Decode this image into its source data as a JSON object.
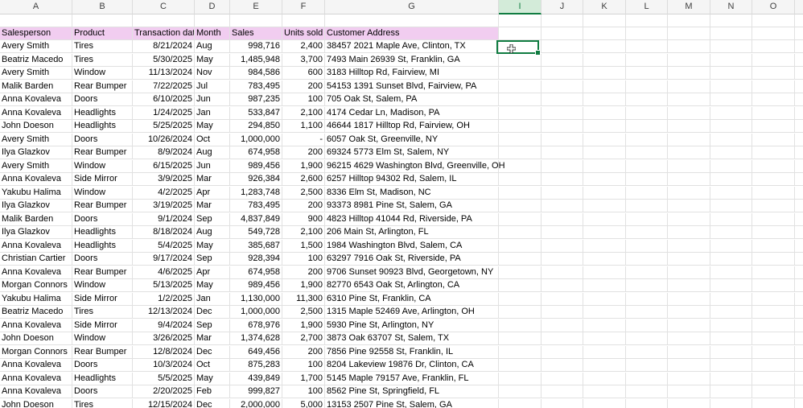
{
  "columns": [
    "A",
    "B",
    "C",
    "D",
    "E",
    "F",
    "G",
    "",
    "I",
    "J",
    "K",
    "L",
    "M",
    "N",
    "O"
  ],
  "selected_column": "I",
  "headers": {
    "salesperson": "Salesperson",
    "product": "Product",
    "transaction_date": "Transaction dat",
    "month": "Month",
    "sales": "Sales",
    "units_sold": "Units sold",
    "customer_address": "Customer Address"
  },
  "rows": [
    [
      "Avery Smith",
      "Tires",
      "8/21/2024",
      "Aug",
      "998,716",
      "2,400",
      "38457 2021 Maple Ave, Clinton, TX"
    ],
    [
      "Beatriz Macedo",
      "Tires",
      "5/30/2025",
      "May",
      "1,485,948",
      "3,700",
      "7493 Main 26939 St, Franklin, GA"
    ],
    [
      "Avery Smith",
      "Window",
      "11/13/2024",
      "Nov",
      "984,586",
      "600",
      "3183 Hilltop Rd, Fairview, MI"
    ],
    [
      "Malik Barden",
      "Rear Bumper",
      "7/22/2025",
      "Jul",
      "783,495",
      "200",
      "54153 1391 Sunset Blvd, Fairview, PA"
    ],
    [
      "Anna Kovaleva",
      "Doors",
      "6/10/2025",
      "Jun",
      "987,235",
      "100",
      "705 Oak St, Salem, PA"
    ],
    [
      "Anna Kovaleva",
      "Headlights",
      "1/24/2025",
      "Jan",
      "533,847",
      "2,100",
      "4174 Cedar Ln, Madison, PA"
    ],
    [
      "John Doeson",
      "Headlights",
      "5/25/2025",
      "May",
      "294,850",
      "1,100",
      "46644 1817 Hilltop Rd, Fairview, OH"
    ],
    [
      "Avery Smith",
      "Doors",
      "10/26/2024",
      "Oct",
      "1,000,000",
      "-",
      "6057 Oak St, Greenville, NY"
    ],
    [
      "Ilya Glazkov",
      "Rear Bumper",
      "8/9/2024",
      "Aug",
      "674,958",
      "200",
      "69324 5773 Elm St, Salem, NY"
    ],
    [
      "Avery Smith",
      "Window",
      "6/15/2025",
      "Jun",
      "989,456",
      "1,900",
      "96215 4629 Washington Blvd, Greenville, OH"
    ],
    [
      "Anna Kovaleva",
      "Side Mirror",
      "3/9/2025",
      "Mar",
      "926,384",
      "2,600",
      "6257 Hilltop 94302 Rd, Salem, IL"
    ],
    [
      "Yakubu Halima",
      "Window",
      "4/2/2025",
      "Apr",
      "1,283,748",
      "2,500",
      "8336 Elm St, Madison, NC"
    ],
    [
      "Ilya Glazkov",
      "Rear Bumper",
      "3/19/2025",
      "Mar",
      "783,495",
      "200",
      "93373 8981 Pine St, Salem, GA"
    ],
    [
      "Malik Barden",
      "Doors",
      "9/1/2024",
      "Sep",
      "4,837,849",
      "900",
      "4823 Hilltop 41044 Rd, Riverside, PA"
    ],
    [
      "Ilya Glazkov",
      "Headlights",
      "8/18/2024",
      "Aug",
      "549,728",
      "2,100",
      "206 Main St, Arlington, FL"
    ],
    [
      "Anna Kovaleva",
      "Headlights",
      "5/4/2025",
      "May",
      "385,687",
      "1,500",
      "1984 Washington Blvd, Salem, CA"
    ],
    [
      "Christian Cartier",
      "Doors",
      "9/17/2024",
      "Sep",
      "928,394",
      "100",
      "63297 7916 Oak St, Riverside, PA"
    ],
    [
      "Anna Kovaleva",
      "Rear Bumper",
      "4/6/2025",
      "Apr",
      "674,958",
      "200",
      "9706 Sunset 90923 Blvd, Georgetown, NY"
    ],
    [
      "Morgan Connors",
      "Window",
      "5/13/2025",
      "May",
      "989,456",
      "1,900",
      "82770 6543 Oak St, Arlington, CA"
    ],
    [
      "Yakubu Halima",
      "Side Mirror",
      "1/2/2025",
      "Jan",
      "1,130,000",
      "11,300",
      "6310 Pine St, Franklin, CA"
    ],
    [
      "Beatriz Macedo",
      "Tires",
      "12/13/2024",
      "Dec",
      "1,000,000",
      "2,500",
      "1315 Maple 52469 Ave, Arlington, OH"
    ],
    [
      "Anna Kovaleva",
      "Side Mirror",
      "9/4/2024",
      "Sep",
      "678,976",
      "1,900",
      "5930 Pine St, Arlington, NY"
    ],
    [
      "John Doeson",
      "Window",
      "3/26/2025",
      "Mar",
      "1,374,628",
      "2,700",
      "3873 Oak 63707 St, Salem, TX"
    ],
    [
      "Morgan Connors",
      "Rear Bumper",
      "12/8/2024",
      "Dec",
      "649,456",
      "200",
      "7856 Pine 92558 St, Franklin, IL"
    ],
    [
      "Anna Kovaleva",
      "Doors",
      "10/3/2024",
      "Oct",
      "875,283",
      "100",
      "8204 Lakeview 19876 Dr, Clinton, CA"
    ],
    [
      "Anna Kovaleva",
      "Headlights",
      "5/5/2025",
      "May",
      "439,849",
      "1,700",
      "5145 Maple 79157 Ave, Franklin, FL"
    ],
    [
      "Anna Kovaleva",
      "Doors",
      "2/20/2025",
      "Feb",
      "999,827",
      "100",
      "8562 Pine St, Springfield, FL"
    ],
    [
      "John Doeson",
      "Tires",
      "12/15/2024",
      "Dec",
      "2,000,000",
      "5,000",
      "13153 2507 Pine St, Salem, GA"
    ]
  ]
}
